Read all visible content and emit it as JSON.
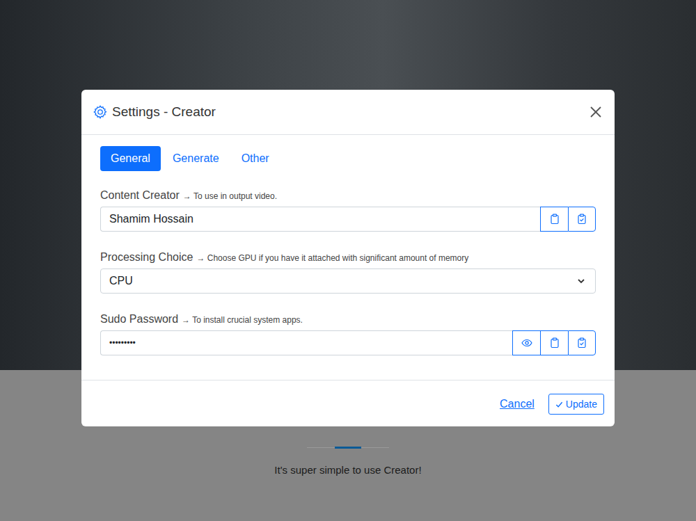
{
  "window": {
    "title": "Settings - Creator"
  },
  "tabs": [
    {
      "label": "General",
      "selected": true
    },
    {
      "label": "Generate",
      "selected": false
    },
    {
      "label": "Other",
      "selected": false
    }
  ],
  "fields": [
    {
      "kind": "text",
      "label": "Content Creator",
      "hint": "→ To use in output video.",
      "value": "Shamim Hossain"
    },
    {
      "kind": "select",
      "label": "Processing Choice",
      "hint": "→ Choose GPU if you have it attached with significant amount of memory",
      "value": "CPU"
    },
    {
      "kind": "password",
      "label": "Sudo Password",
      "hint": "→ To install crucial system apps.",
      "value": "•••••••••"
    }
  ],
  "footer": {
    "cancel": "Cancel",
    "update": "Update"
  },
  "page": {
    "tagline": "It's super simple to use Creator!"
  }
}
